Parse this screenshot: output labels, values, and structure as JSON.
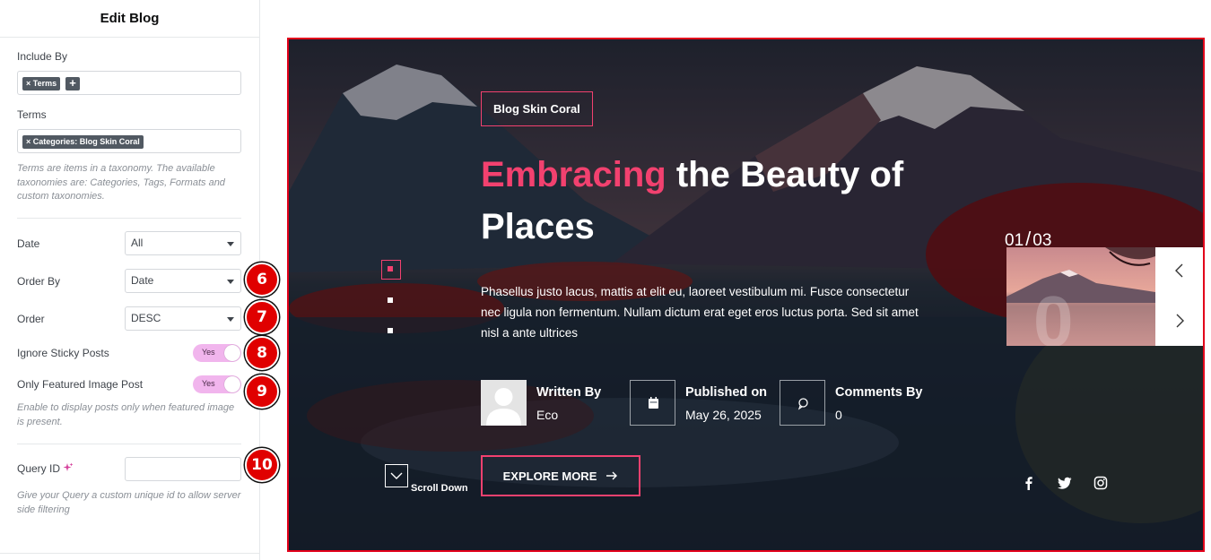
{
  "panel": {
    "title": "Edit Blog",
    "include_by": {
      "label": "Include By",
      "tag": "× Terms",
      "add": "+"
    },
    "terms": {
      "label": "Terms",
      "tag": "× Categories: Blog Skin Coral",
      "help": "Terms are items in a taxonomy. The available taxonomies are: Categories, Tags, Formats and custom taxonomies."
    },
    "date": {
      "label": "Date",
      "value": "All"
    },
    "order_by": {
      "label": "Order By",
      "value": "Date"
    },
    "order": {
      "label": "Order",
      "value": "DESC"
    },
    "ignore_sticky": {
      "label": "Ignore Sticky Posts",
      "value": "Yes"
    },
    "only_featured": {
      "label": "Only Featured Image Post",
      "value": "Yes",
      "help": "Enable to display posts only when featured image is present."
    },
    "query_id": {
      "label": "Query ID",
      "value": "",
      "help": "Give your Query a custom unique id to allow server side filtering"
    }
  },
  "badges": [
    "6",
    "7",
    "8",
    "9",
    "10"
  ],
  "preview": {
    "category": "Blog Skin Coral",
    "headline_accent": "Embracing",
    "headline_rest": "the Beauty of Places",
    "excerpt": "Phasellus justo lacus, mattis at elit eu, laoreet vestibulum mi. Fusce consectetur nec ligula non fermentum. Nullam dictum erat eget eros luctus porta. Sed sit amet nisl a ante ultrices",
    "author": {
      "title": "Written By",
      "value": "Eco"
    },
    "published": {
      "title": "Published on",
      "value": "May 26, 2025"
    },
    "comments": {
      "title": "Comments By",
      "value": "0"
    },
    "button": "EXPLORE MORE",
    "scroll": "Scroll Down",
    "counter_current": "01",
    "counter_total": "03",
    "icons": [
      "calendar-icon",
      "comment-icon",
      "facebook-icon",
      "twitter-icon",
      "instagram-icon",
      "chevron-left-icon",
      "chevron-right-icon",
      "arrow-right-icon",
      "chevron-down-icon"
    ]
  },
  "colors": {
    "accent": "#f2416f",
    "badge": "#e00000",
    "toggle": "#f1b5ed",
    "frame": "#e2001a"
  }
}
